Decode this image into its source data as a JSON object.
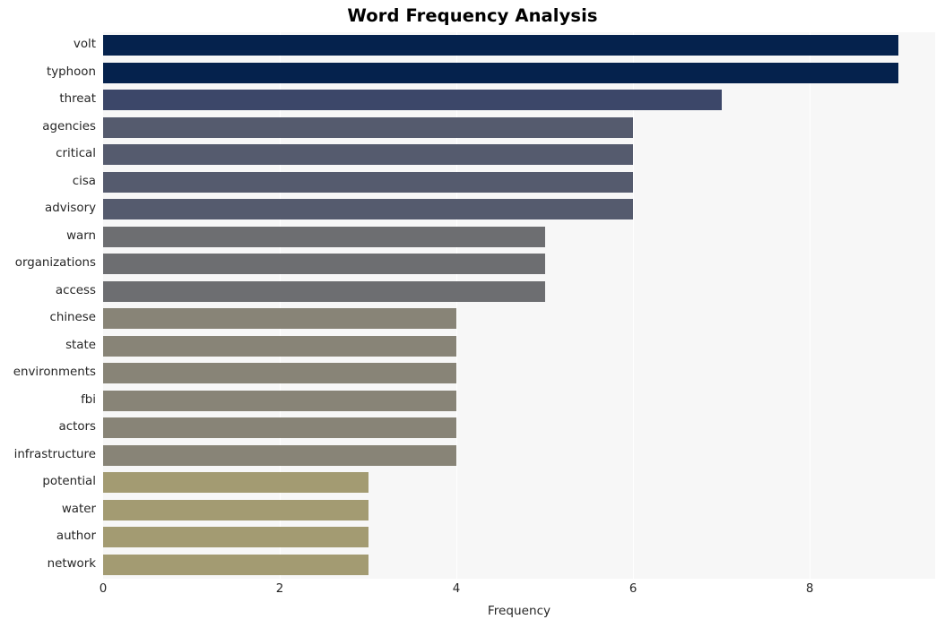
{
  "chart_data": {
    "type": "bar",
    "orientation": "horizontal",
    "title": "Word Frequency Analysis",
    "xlabel": "Frequency",
    "ylabel": "",
    "categories": [
      "volt",
      "typhoon",
      "threat",
      "agencies",
      "critical",
      "cisa",
      "advisory",
      "warn",
      "organizations",
      "access",
      "chinese",
      "state",
      "environments",
      "fbi",
      "actors",
      "infrastructure",
      "potential",
      "water",
      "author",
      "network"
    ],
    "values": [
      9,
      9,
      7,
      6,
      6,
      6,
      6,
      5,
      5,
      5,
      4,
      4,
      4,
      4,
      4,
      4,
      3,
      3,
      3,
      3
    ],
    "bar_colors": [
      "#05224d",
      "#05224d",
      "#3c4769",
      "#555b6e",
      "#555b6e",
      "#555b6e",
      "#555b6e",
      "#6d6e71",
      "#6d6e71",
      "#6d6e71",
      "#888477",
      "#888477",
      "#888477",
      "#888477",
      "#888477",
      "#888477",
      "#a39b72",
      "#a39b72",
      "#a39b72",
      "#a39b72"
    ],
    "xticks": [
      0,
      2,
      4,
      6,
      8
    ],
    "xtick_labels": [
      "0",
      "2",
      "4",
      "6",
      "8"
    ],
    "xlim": [
      0,
      9.42
    ],
    "grid": "vertical-white",
    "legend": "none",
    "plot_background": "#f7f7f7",
    "figure_background": "#ffffff"
  }
}
